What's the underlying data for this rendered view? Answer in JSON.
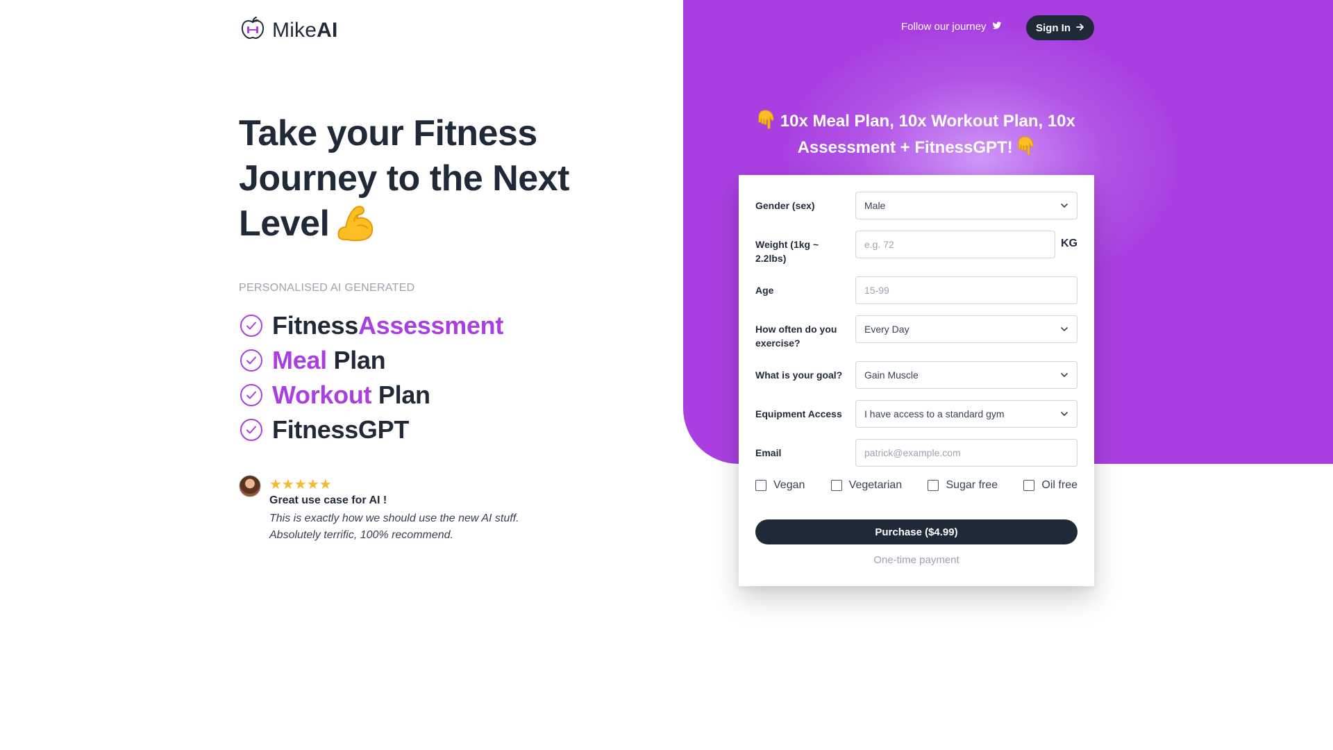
{
  "colors": {
    "accent": "#a93fe0",
    "dark": "#1f2937",
    "star": "#f5b82e"
  },
  "header": {
    "logo_prefix": "Mike",
    "logo_suffix": "AI",
    "logo_icon": "apple-dumbbell-icon",
    "follow_label": "Follow our journey",
    "follow_icon": "twitter-icon",
    "signin_label": "Sign In",
    "signin_icon": "arrow-right-icon"
  },
  "hero": {
    "title_text": "Take your Fitness Journey to the Next Level",
    "title_emoji": "flexed-biceps-icon",
    "eyebrow": "PERSONALISED AI GENERATED",
    "features": [
      {
        "plain_before": "Fitness ",
        "accent": "Assessment",
        "plain_after": ""
      },
      {
        "plain_before": "",
        "accent": "Meal",
        "plain_after": " Plan"
      },
      {
        "plain_before": "",
        "accent": "Workout",
        "plain_after": " Plan"
      },
      {
        "plain_before": "FitnessGPT",
        "accent": "",
        "plain_after": ""
      }
    ]
  },
  "review": {
    "stars": "★★★★★",
    "rating": 5,
    "title": "Great use case for AI !",
    "body": "This is exactly how we should use the new AI stuff. Absolutely terrific, 100% recommend."
  },
  "offer": {
    "text": "10x Meal Plan, 10x Workout Plan, 10x Assessment + FitnessGPT!",
    "emoji": "pointing-down-hand-icon"
  },
  "form": {
    "gender": {
      "label": "Gender (sex)",
      "value": "Male"
    },
    "weight": {
      "label": "Weight (1kg ~ 2.2lbs)",
      "placeholder": "e.g. 72",
      "unit": "KG"
    },
    "age": {
      "label": "Age",
      "placeholder": "15-99"
    },
    "exercise": {
      "label": "How often do you exercise?",
      "value": "Every Day"
    },
    "goal": {
      "label": "What is your goal?",
      "value": "Gain Muscle"
    },
    "equipment": {
      "label": "Equipment Access",
      "value": "I have access to a standard gym"
    },
    "email": {
      "label": "Email",
      "placeholder": "patrick@example.com"
    },
    "diets": [
      "Vegan",
      "Vegetarian",
      "Sugar free",
      "Oil free"
    ],
    "purchase_label": "Purchase ($4.99)",
    "payment_note": "One-time payment"
  }
}
